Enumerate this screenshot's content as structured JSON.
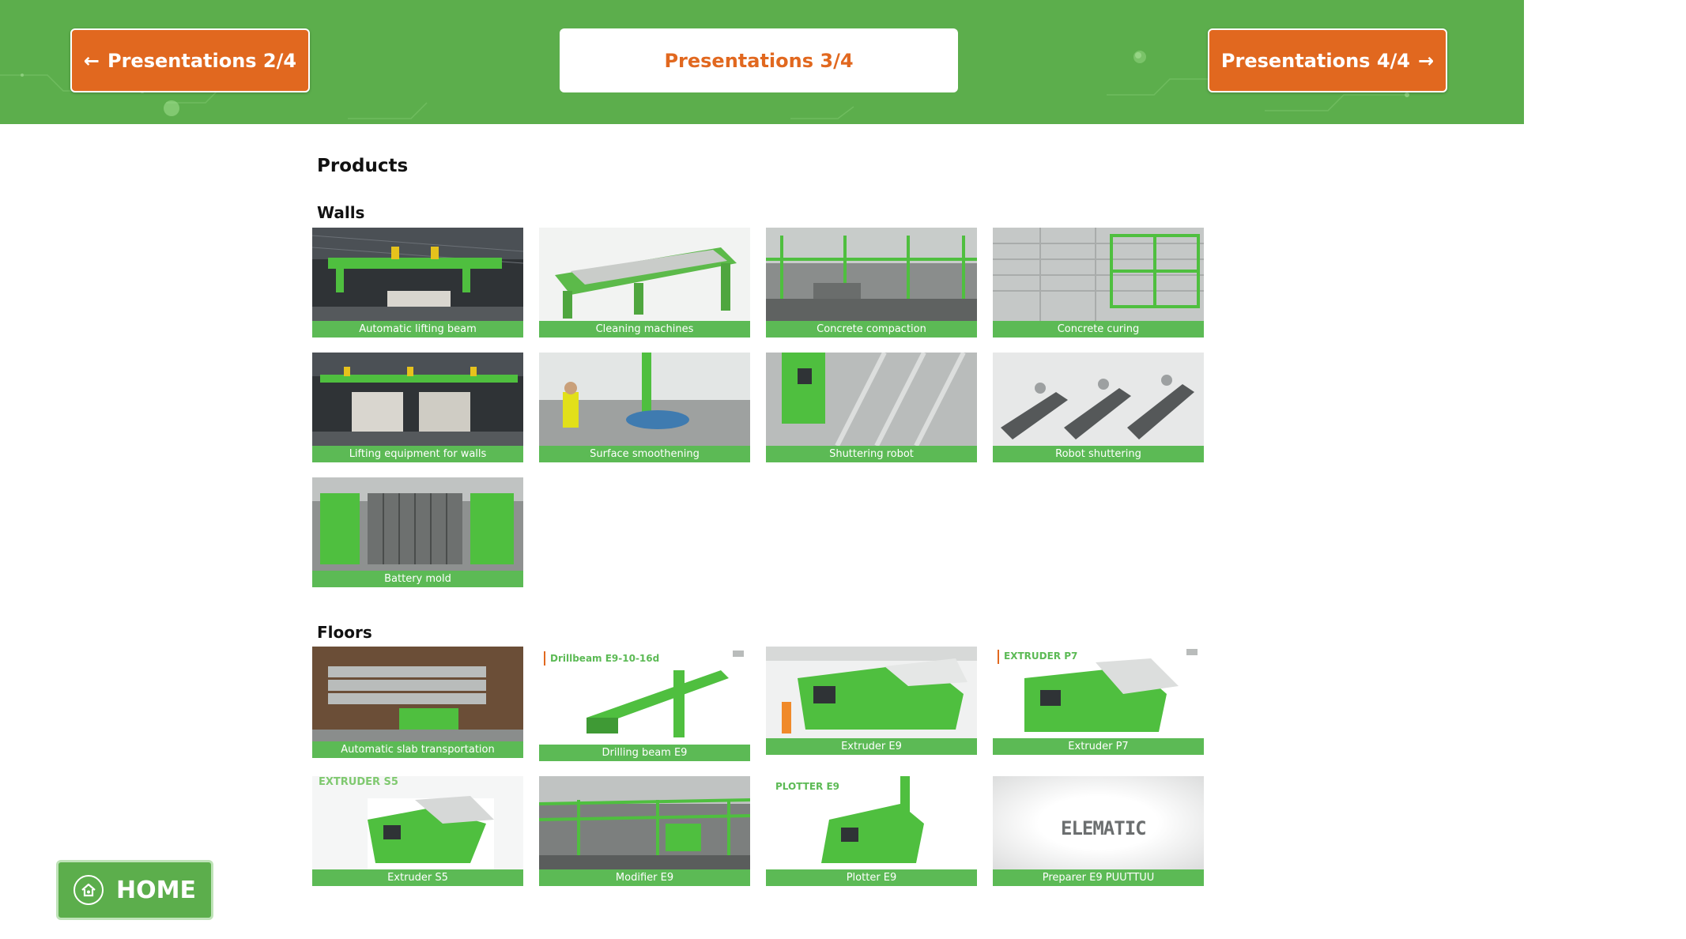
{
  "header": {
    "prev_label": "Presentations 2/4",
    "current_label": "Presentations 3/4",
    "next_label": "Presentations 4/4",
    "prev_arrow": "←",
    "next_arrow": "→"
  },
  "content": {
    "title": "Products",
    "walls": {
      "heading": "Walls",
      "items": [
        {
          "caption": "Automatic lifting beam"
        },
        {
          "caption": "Cleaning machines"
        },
        {
          "caption": "Concrete compaction"
        },
        {
          "caption": "Concrete curing"
        },
        {
          "caption": "Lifting equipment for walls"
        },
        {
          "caption": "Surface smoothening"
        },
        {
          "caption": "Shuttering robot"
        },
        {
          "caption": "Robot shuttering"
        },
        {
          "caption": "Battery mold"
        }
      ]
    },
    "floors": {
      "heading": "Floors",
      "items": [
        {
          "caption": "Automatic slab transportation"
        },
        {
          "caption": "Drilling beam E9",
          "brand": "Drillbeam E9-10-16d"
        },
        {
          "caption": "Extruder E9"
        },
        {
          "caption": "Extruder P7",
          "brand": "EXTRUDER P7"
        },
        {
          "caption": "Extruder S5",
          "brand": "EXTRUDER S5"
        },
        {
          "caption": "Modifier E9"
        },
        {
          "caption": "Plotter E9",
          "brand": "PLOTTER E9"
        },
        {
          "caption": "Preparer E9 PUUTTUU",
          "brand": "ELEMATIC"
        }
      ]
    }
  },
  "home": {
    "label": "HOME",
    "icon": "home-icon"
  },
  "colors": {
    "brand_green": "#5cae4c",
    "caption_green": "#5cba55",
    "accent_orange": "#e1681f"
  }
}
